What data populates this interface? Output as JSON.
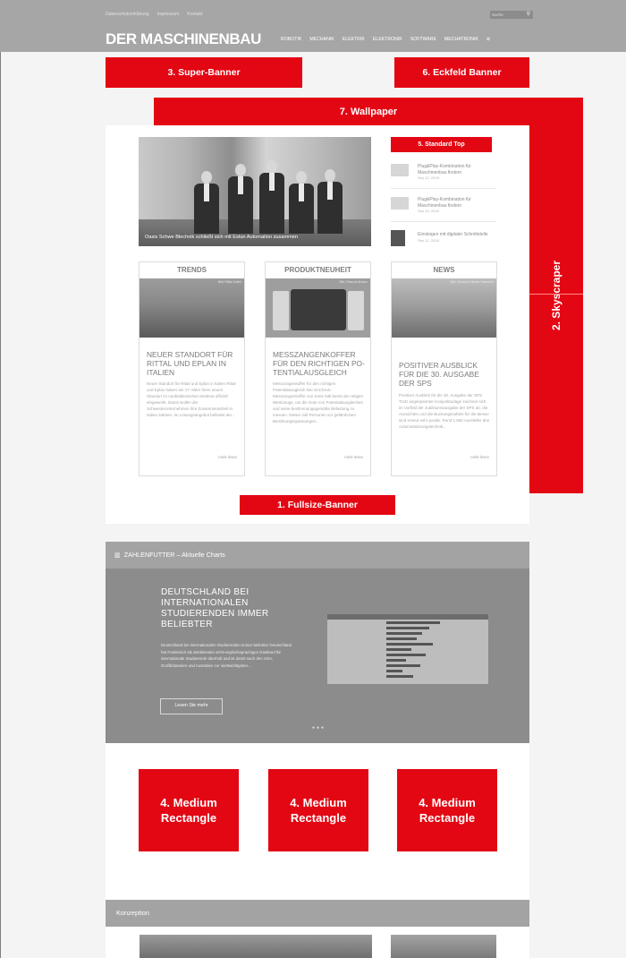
{
  "header": {
    "util_links": [
      "Datenschutzerklärung",
      "Impressum",
      "Kontakt"
    ],
    "search_placeholder": "Suche",
    "logo": "DER MASCHINENBAU",
    "nav": [
      "ROBOTIK",
      "MECHANIK",
      "ELEKTRIK",
      "ELEKTRONIK",
      "SOFTWARE",
      "MECHATRONIK"
    ]
  },
  "ads": {
    "super_banner": "3. Super-Banner",
    "eckfeld_banner": "6. Eckfeld Banner",
    "wallpaper": "7. Wallpaper",
    "standard_top": "5. Standard Top",
    "skyscraper": "2. Skyscraper",
    "fullsize_banner": "1. Fullsize-Banner",
    "medium_rectangle_line1": "4. Medium",
    "medium_rectangle_line2": "Rectangle"
  },
  "hero": {
    "caption": "Oasis Schwe Blechnik schließt sich mit Estun Automation zusammen"
  },
  "side_news": [
    {
      "title": "Plug&Play-Kombination für Maschinenbau findern",
      "date": "Sep 12, 2018"
    },
    {
      "title": "Plug&Play-Kombination für Maschinenbau findern",
      "date": "Sep 12, 2018"
    },
    {
      "title": "Einsteigen mit digitaler Schnittstelle",
      "date": "Sep 12, 2018"
    }
  ],
  "cards": [
    {
      "header": "TRENDS",
      "tag": "Bild: Rittal GmbH",
      "title": "NEUER STANDORT FÜR RITTAL UND EPLAN IN ITALIEN",
      "excerpt": "Neuer Standort für Rittal und Eplan in Italien Rittal und Eplan haben am 17. März ihren neuen Standort im norditalienischen Modena offiziell eingeweiht. Damit wollen die Schwesterunternehmen ihre Zusammenarbeit in Italien stärken. Im Lösungsangebot befindet der...",
      "more": "mehr lesen"
    },
    {
      "header": "PRODUKTNEUHEIT",
      "tag": "Bild: Chauvin Arnoux",
      "title": "MESSZANGENKOFFER FÜR DEN RICHTIGEN PO-TENTIALAUSGLEICH",
      "excerpt": "Messzangenkoffer für den richtigen Potentialausgleich Der EnCheck-Messzangenkoffer von Kreis hält bereit die nötigen Werkzeuge, um die Güte von Potentialausgleichen und seine bestimmungsgemäße Belastung zu messen. Dieser soll Personen vor gefährlichen Berührungsspannungen...",
      "more": "mehr lesen"
    },
    {
      "header": "NEWS",
      "tag": "Bild: Deutsche Messe Hannover",
      "title": "POSITIVER AUSBLICK FÜR DIE 30. AUSGABE DER SPS",
      "excerpt": "Positiver Ausblick für die 30. Ausgabe der SPS Trotz angespannter Konjunkturlage zeichnet sich im Vorfeld der Jubiläumsausgabe der SPS ab, die Aussichten und die Buchungszahlen für die Messe sind erneut sehr positiv. Rund 1.650 Aussteller den Automatisierungstechnik...",
      "more": "mehr lesen"
    }
  ],
  "zahlenfutter": {
    "bar_label": "ZAHLENFUTTER – Aktuelle Charts",
    "title": "DEUTSCHLAND BEI INTERNATIONALEN STUDIERENDEN IMMER BELIEBTER",
    "excerpt": "Deutschland bei internationalen Studierenden immer beliebter Deutschland hat Frankreich als attraktivstes nicht-englischsprachiges Gastland für internationale Studierende überholt und ist damit nach den USA, Großbritannien und Australien zur viertwichtigsten...",
    "button": "Lesen Sie mehr",
    "dots": "●●●"
  },
  "konzeption": {
    "bar_label": "Konzeption"
  },
  "colors": {
    "accent_red": "#e30613",
    "header_gray": "#a6a6a6",
    "section_gray": "#8c8c8c"
  }
}
